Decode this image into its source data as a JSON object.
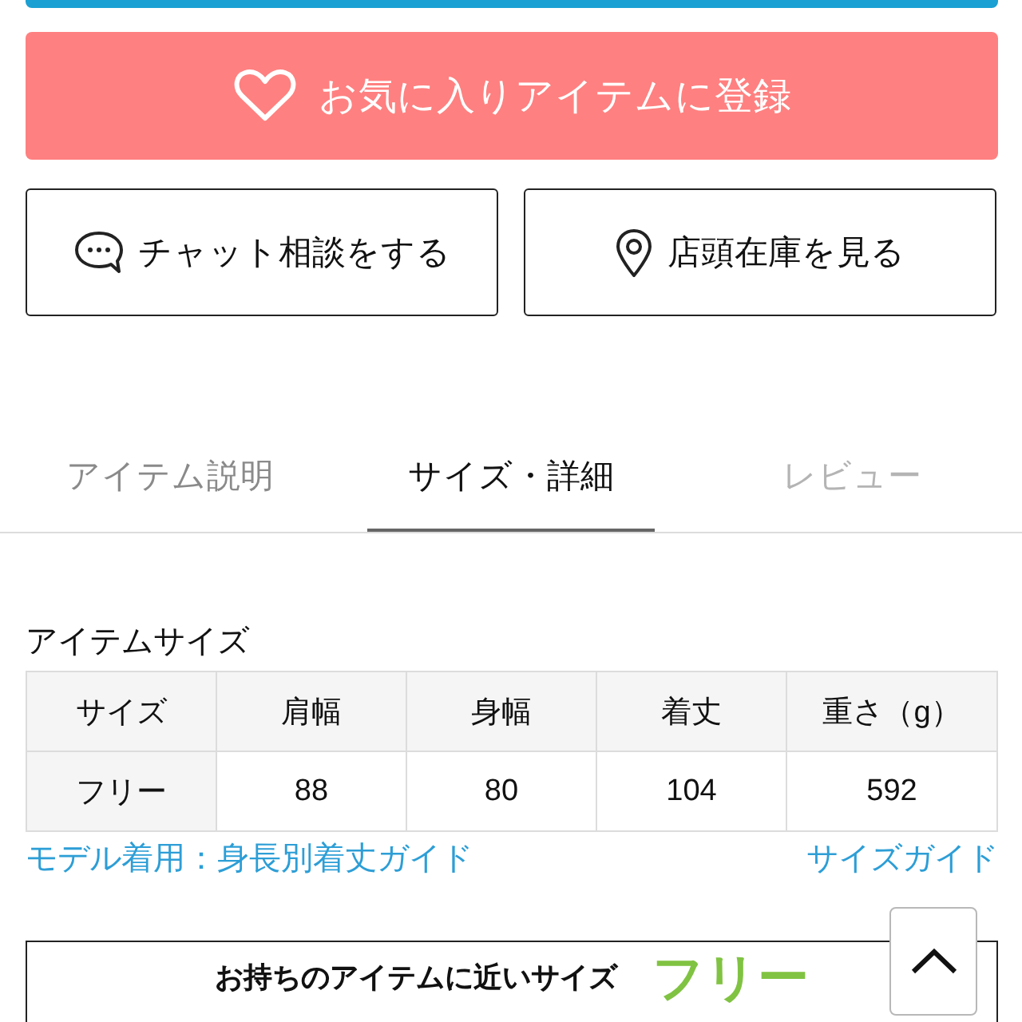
{
  "favorite_button": {
    "label": "お気に入りアイテムに登録"
  },
  "action_buttons": [
    {
      "kind": "chat",
      "label": "チャット相談をする"
    },
    {
      "kind": "store",
      "label": "店頭在庫を見る"
    }
  ],
  "tabs": [
    {
      "label": "アイテム説明",
      "selected": false,
      "disabled": false
    },
    {
      "label": "サイズ・詳細",
      "selected": true,
      "disabled": false
    },
    {
      "label": "レビュー",
      "selected": false,
      "disabled": true
    }
  ],
  "size_section": {
    "title": "アイテムサイズ",
    "table": {
      "columns": [
        "サイズ",
        "肩幅",
        "身幅",
        "着丈",
        "重さ（g）"
      ],
      "rows": [
        [
          "フリー",
          "88",
          "80",
          "104",
          "592"
        ]
      ]
    },
    "links": [
      {
        "label": "モデル着用：身長別着丈ガイド"
      },
      {
        "label": "サイズガイド"
      }
    ]
  },
  "recommendation": {
    "label": "お持ちのアイテムに近いサイズ",
    "size": "フリー"
  }
}
